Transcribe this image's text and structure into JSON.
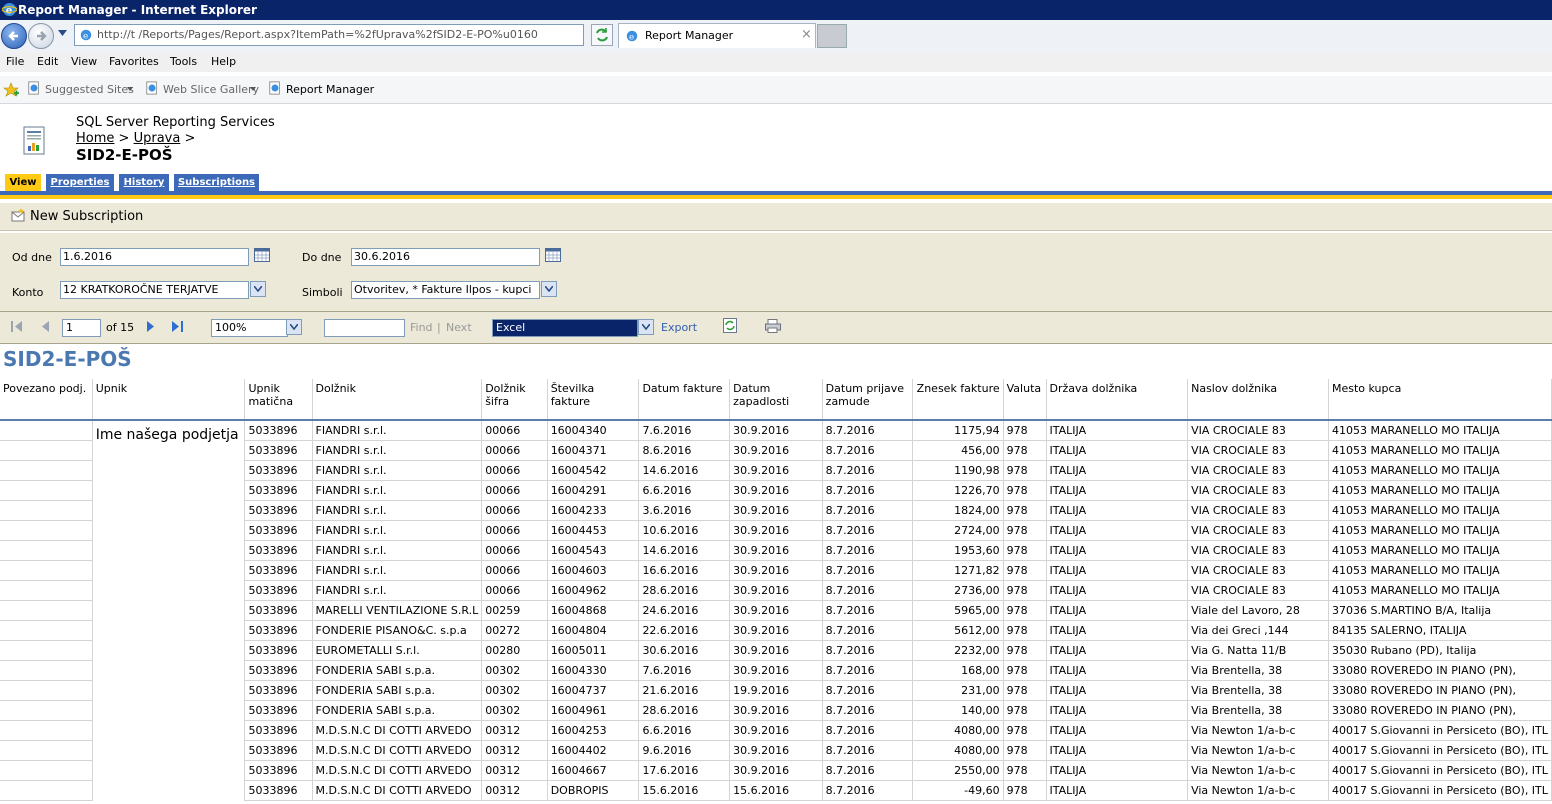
{
  "window": {
    "title": "Report Manager - Internet Explorer"
  },
  "address_bar": {
    "url": "http://t          /Reports/Pages/Report.aspx?ItemPath=%2fUprava%2fSID2-E-PO%u0160"
  },
  "browser_tab": {
    "label": "Report Manager",
    "close": "×"
  },
  "menu": [
    "File",
    "Edit",
    "View",
    "Favorites",
    "Tools",
    "Help"
  ],
  "favorites": {
    "suggested": "Suggested Sites",
    "webslice": "Web Slice Gallery",
    "reportmanager": "Report Manager"
  },
  "ssrs": {
    "title": "SQL Server Reporting Services",
    "crumb_home": "Home",
    "crumb_sep1": ">",
    "crumb_uprava": "Uprava",
    "crumb_sep2": ">",
    "report_name": "SID2-E-POŠ"
  },
  "report_tabs": {
    "view": "View",
    "properties": "Properties",
    "history": "History",
    "subscriptions": "Subscriptions"
  },
  "subscription": {
    "new": "New Subscription"
  },
  "parameters": {
    "from_label": "Od dne",
    "from_value": "1.6.2016",
    "to_label": "Do dne",
    "to_value": "30.6.2016",
    "konto_label": "Konto",
    "konto_value": "12     KRATKOROČNE TERJATVE",
    "symbols_label": "Simboli",
    "symbols_value": "Otvoritev, * Fakture Ilpos - kupci"
  },
  "report_toolbar": {
    "page": "1",
    "of_pages": "of 15",
    "zoom": "100%",
    "find_text": "",
    "find": "Find",
    "sep": "|",
    "next": "Next",
    "format": "Excel",
    "export": "Export"
  },
  "report": {
    "heading": "SID2-E-POŠ",
    "upnik_value": "Ime našega podjetja",
    "columns": [
      "Povezano podj.",
      "Upnik",
      "Upnik matična",
      "Dolžnik",
      "Dolžnik šifra",
      "Številka fakture",
      "Datum fakture",
      "Datum zapadlosti",
      "Datum prijave zamude",
      "Znesek fakture",
      "Valuta",
      "Država dolžnika",
      "Naslov dolžnika",
      "Mesto kupca"
    ],
    "rows": [
      [
        "5033896",
        "FIANDRI s.r.l.",
        "00066",
        "16004340",
        "7.6.2016",
        "30.9.2016",
        "8.7.2016",
        "1175,94",
        "978",
        "ITALIJA",
        "VIA CROCIALE 83",
        "41053 MARANELLO MO ITALIJA"
      ],
      [
        "5033896",
        "FIANDRI s.r.l.",
        "00066",
        "16004371",
        "8.6.2016",
        "30.9.2016",
        "8.7.2016",
        "456,00",
        "978",
        "ITALIJA",
        "VIA CROCIALE 83",
        "41053 MARANELLO MO ITALIJA"
      ],
      [
        "5033896",
        "FIANDRI s.r.l.",
        "00066",
        "16004542",
        "14.6.2016",
        "30.9.2016",
        "8.7.2016",
        "1190,98",
        "978",
        "ITALIJA",
        "VIA CROCIALE 83",
        "41053 MARANELLO MO ITALIJA"
      ],
      [
        "5033896",
        "FIANDRI s.r.l.",
        "00066",
        "16004291",
        "6.6.2016",
        "30.9.2016",
        "8.7.2016",
        "1226,70",
        "978",
        "ITALIJA",
        "VIA CROCIALE 83",
        "41053 MARANELLO MO ITALIJA"
      ],
      [
        "5033896",
        "FIANDRI s.r.l.",
        "00066",
        "16004233",
        "3.6.2016",
        "30.9.2016",
        "8.7.2016",
        "1824,00",
        "978",
        "ITALIJA",
        "VIA CROCIALE 83",
        "41053 MARANELLO MO ITALIJA"
      ],
      [
        "5033896",
        "FIANDRI s.r.l.",
        "00066",
        "16004453",
        "10.6.2016",
        "30.9.2016",
        "8.7.2016",
        "2724,00",
        "978",
        "ITALIJA",
        "VIA CROCIALE 83",
        "41053 MARANELLO MO ITALIJA"
      ],
      [
        "5033896",
        "FIANDRI s.r.l.",
        "00066",
        "16004543",
        "14.6.2016",
        "30.9.2016",
        "8.7.2016",
        "1953,60",
        "978",
        "ITALIJA",
        "VIA CROCIALE 83",
        "41053 MARANELLO MO ITALIJA"
      ],
      [
        "5033896",
        "FIANDRI s.r.l.",
        "00066",
        "16004603",
        "16.6.2016",
        "30.9.2016",
        "8.7.2016",
        "1271,82",
        "978",
        "ITALIJA",
        "VIA CROCIALE 83",
        "41053 MARANELLO MO ITALIJA"
      ],
      [
        "5033896",
        "FIANDRI s.r.l.",
        "00066",
        "16004962",
        "28.6.2016",
        "30.9.2016",
        "8.7.2016",
        "2736,00",
        "978",
        "ITALIJA",
        "VIA CROCIALE 83",
        "41053 MARANELLO MO ITALIJA"
      ],
      [
        "5033896",
        "MARELLI VENTILAZIONE S.R.L",
        "00259",
        "16004868",
        "24.6.2016",
        "30.9.2016",
        "8.7.2016",
        "5965,00",
        "978",
        "ITALIJA",
        "Viale del Lavoro, 28",
        "37036 S.MARTINO B/A, Italija"
      ],
      [
        "5033896",
        "FONDERIE PISANO&C. s.p.a",
        "00272",
        "16004804",
        "22.6.2016",
        "30.9.2016",
        "8.7.2016",
        "5612,00",
        "978",
        "ITALIJA",
        "Via dei Greci ,144",
        "84135 SALERNO, ITALIJA"
      ],
      [
        "5033896",
        "EUROMETALLI S.r.l.",
        "00280",
        "16005011",
        "30.6.2016",
        "30.9.2016",
        "8.7.2016",
        "2232,00",
        "978",
        "ITALIJA",
        "Via G. Natta 11/B",
        "35030 Rubano (PD), Italija"
      ],
      [
        "5033896",
        "FONDERIA SABI s.p.a.",
        "00302",
        "16004330",
        "7.6.2016",
        "30.9.2016",
        "8.7.2016",
        "168,00",
        "978",
        "ITALIJA",
        "Via Brentella, 38",
        "33080 ROVEREDO IN PIANO (PN),"
      ],
      [
        "5033896",
        "FONDERIA SABI s.p.a.",
        "00302",
        "16004737",
        "21.6.2016",
        "19.9.2016",
        "8.7.2016",
        "231,00",
        "978",
        "ITALIJA",
        "Via Brentella, 38",
        "33080 ROVEREDO IN PIANO (PN),"
      ],
      [
        "5033896",
        "FONDERIA SABI s.p.a.",
        "00302",
        "16004961",
        "28.6.2016",
        "30.9.2016",
        "8.7.2016",
        "140,00",
        "978",
        "ITALIJA",
        "Via Brentella, 38",
        "33080 ROVEREDO IN PIANO (PN),"
      ],
      [
        "5033896",
        "M.D.S.N.C DI COTTI ARVEDO",
        "00312",
        "16004253",
        "6.6.2016",
        "30.9.2016",
        "8.7.2016",
        "4080,00",
        "978",
        "ITALIJA",
        "Via Newton 1/a-b-c",
        "40017 S.Giovanni in Persiceto (BO), ITL"
      ],
      [
        "5033896",
        "M.D.S.N.C DI COTTI ARVEDO",
        "00312",
        "16004402",
        "9.6.2016",
        "30.9.2016",
        "8.7.2016",
        "4080,00",
        "978",
        "ITALIJA",
        "Via Newton 1/a-b-c",
        "40017 S.Giovanni in Persiceto (BO), ITL"
      ],
      [
        "5033896",
        "M.D.S.N.C DI COTTI ARVEDO",
        "00312",
        "16004667",
        "17.6.2016",
        "30.9.2016",
        "8.7.2016",
        "2550,00",
        "978",
        "ITALIJA",
        "Via Newton 1/a-b-c",
        "40017 S.Giovanni in Persiceto (BO), ITL"
      ],
      [
        "5033896",
        "M.D.S.N.C DI COTTI ARVEDO",
        "00312",
        "DOBROPIS",
        "15.6.2016",
        "15.6.2016",
        "8.7.2016",
        "-49,60",
        "978",
        "ITALIJA",
        "Via Newton 1/a-b-c",
        "40017 S.Giovanni in Persiceto (BO), ITL"
      ]
    ]
  }
}
